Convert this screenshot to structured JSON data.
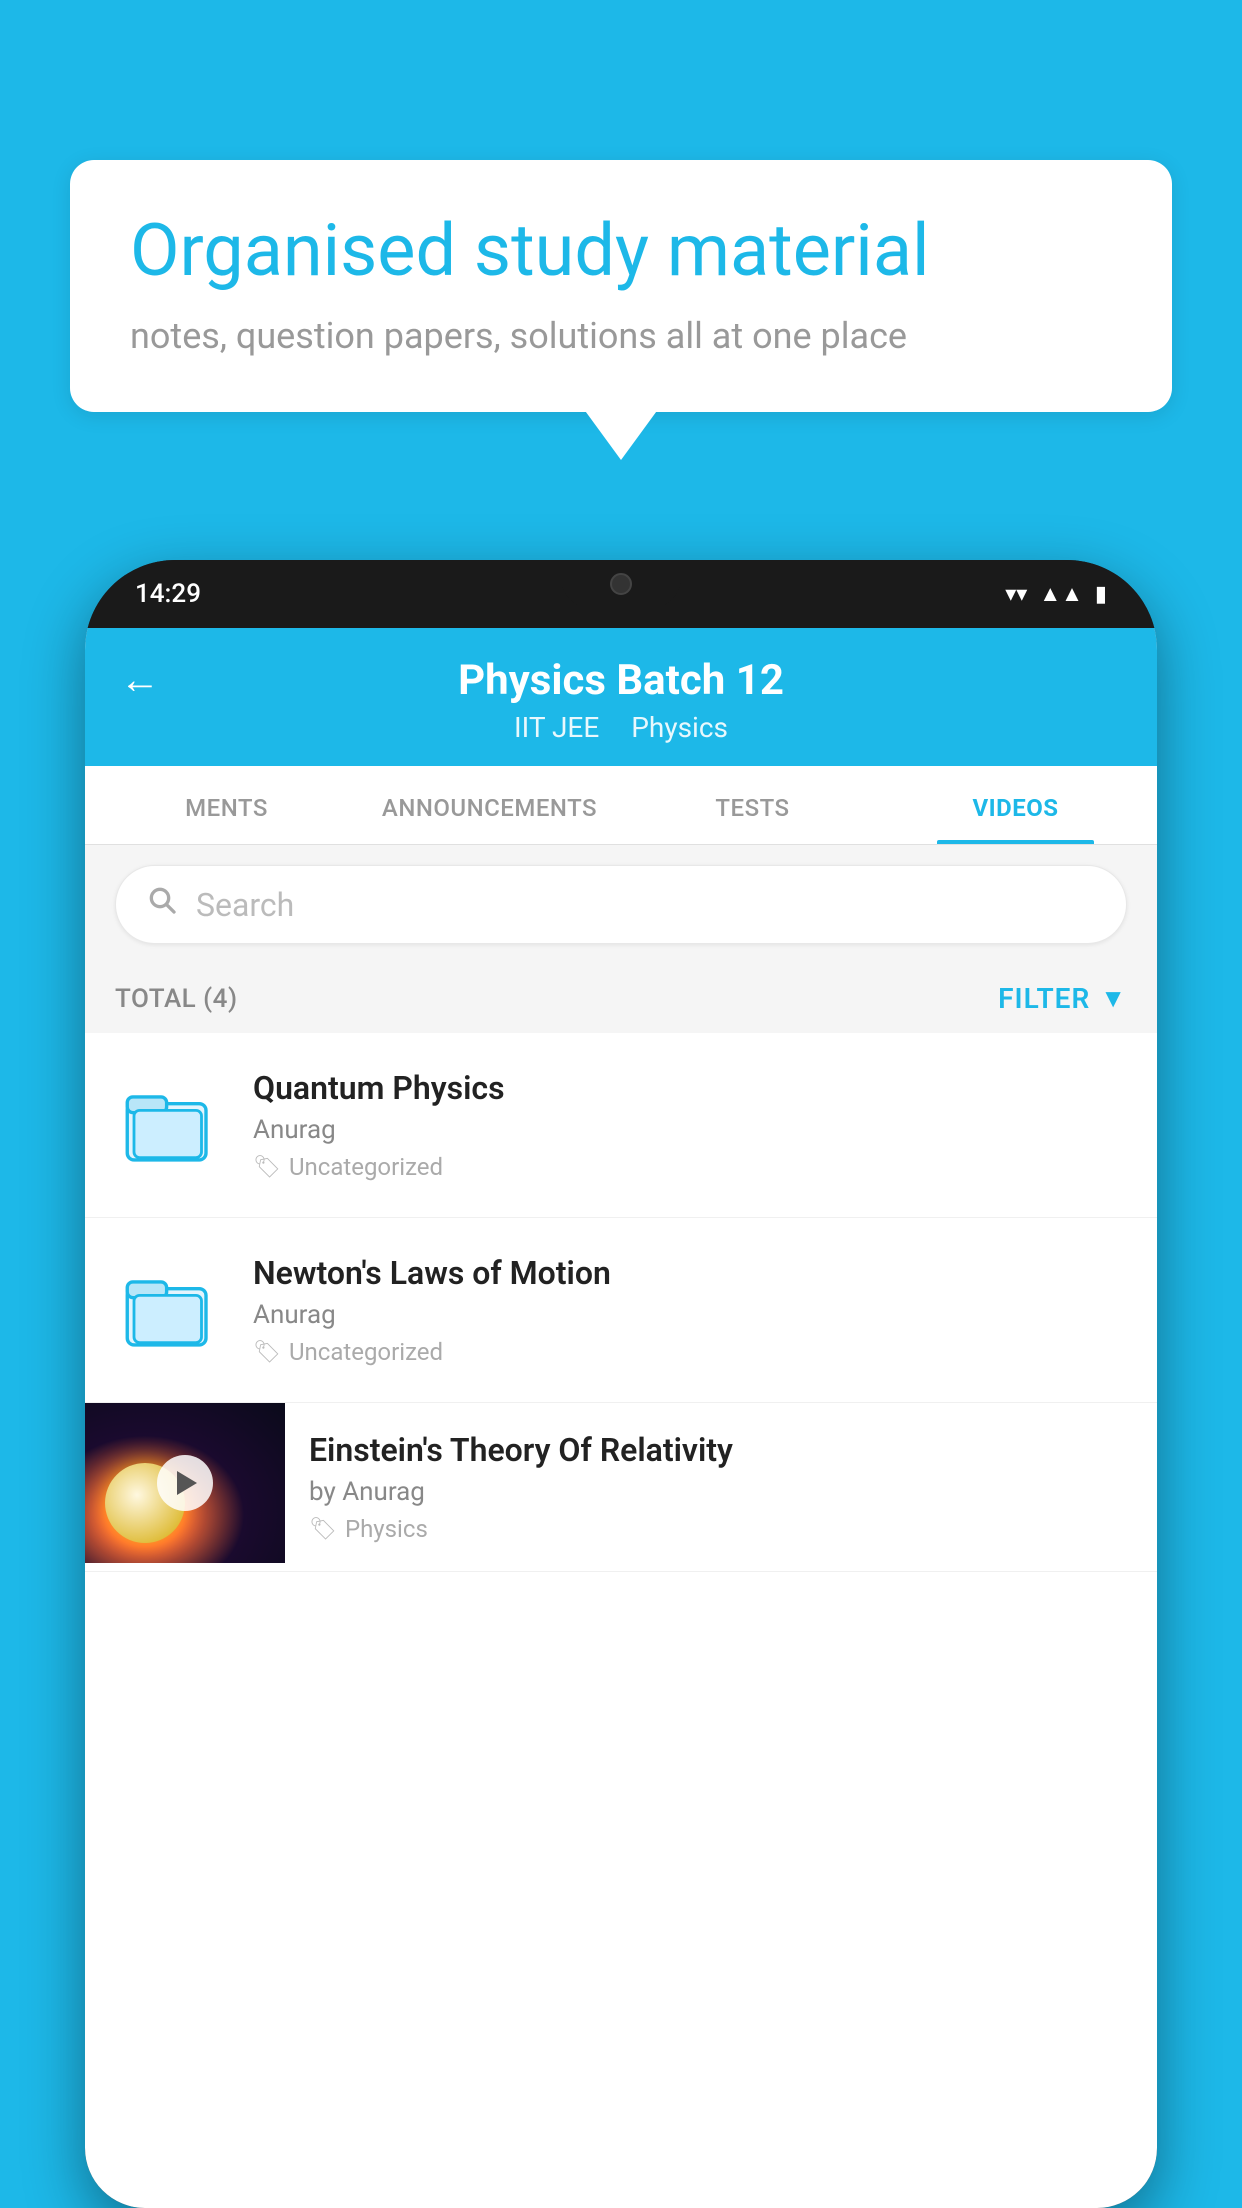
{
  "background": {
    "color": "#1db8e8"
  },
  "speech_bubble": {
    "title": "Organised study material",
    "subtitle": "notes, question papers, solutions all at one place"
  },
  "phone": {
    "status_bar": {
      "time": "14:29"
    },
    "app_header": {
      "title": "Physics Batch 12",
      "subtitle_tag1": "IIT JEE",
      "subtitle_tag2": "Physics",
      "back_icon": "←"
    },
    "tabs": [
      {
        "label": "MENTS",
        "active": false
      },
      {
        "label": "ANNOUNCEMENTS",
        "active": false
      },
      {
        "label": "TESTS",
        "active": false
      },
      {
        "label": "VIDEOS",
        "active": true
      }
    ],
    "search": {
      "placeholder": "Search"
    },
    "filter_bar": {
      "total_label": "TOTAL (4)",
      "filter_label": "FILTER"
    },
    "videos": [
      {
        "id": "quantum",
        "title": "Quantum Physics",
        "author": "Anurag",
        "tag": "Uncategorized",
        "type": "folder"
      },
      {
        "id": "newton",
        "title": "Newton's Laws of Motion",
        "author": "Anurag",
        "tag": "Uncategorized",
        "type": "folder"
      },
      {
        "id": "einstein",
        "title": "Einstein's Theory Of Relativity",
        "author": "by Anurag",
        "tag": "Physics",
        "type": "video"
      }
    ]
  }
}
